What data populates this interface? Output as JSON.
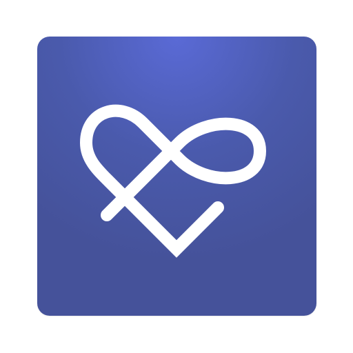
{
  "icon": {
    "name": "heart-infinity-logo",
    "colors": {
      "background_base": "#45529a",
      "background_mid": "#4a5aac",
      "background_glow": "#5a6ad6",
      "stroke": "#ffffff"
    }
  }
}
